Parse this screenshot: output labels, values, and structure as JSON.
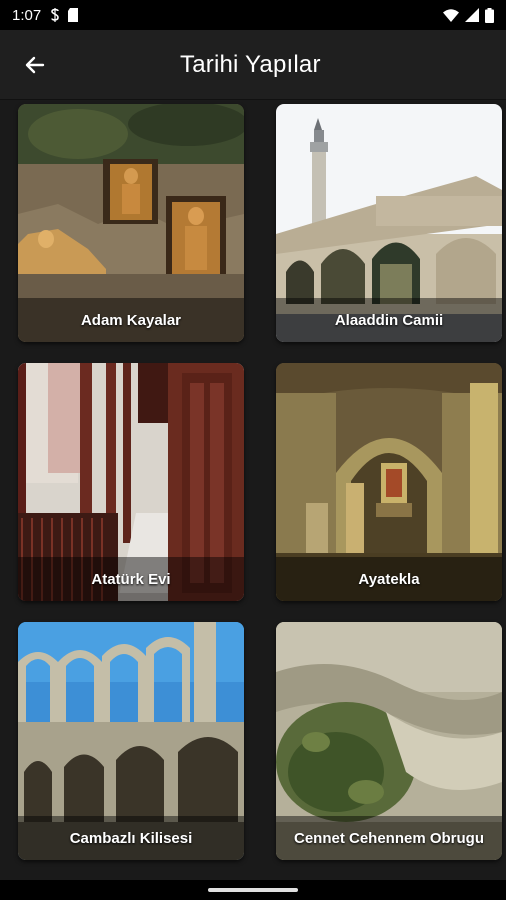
{
  "status_bar": {
    "time": "1:07",
    "left_icons": [
      "sim-s-icon",
      "sd-card-icon"
    ],
    "right_icons": [
      "wifi-icon",
      "signal-icon",
      "battery-icon"
    ]
  },
  "app_bar": {
    "back_icon": "arrow-left-icon",
    "title": "Tarihi Yapılar"
  },
  "places": [
    {
      "label": "Adam Kayalar"
    },
    {
      "label": "Alaaddin Camii"
    },
    {
      "label": "Atatürk Evi"
    },
    {
      "label": "Ayatekla"
    },
    {
      "label": "Cambazlı Kilisesi"
    },
    {
      "label": "Cennet Cehennem Obrugu"
    }
  ],
  "colors": {
    "background": "#1a1a1a",
    "app_bar": "#1f1f1f",
    "status_bar": "#000000"
  }
}
